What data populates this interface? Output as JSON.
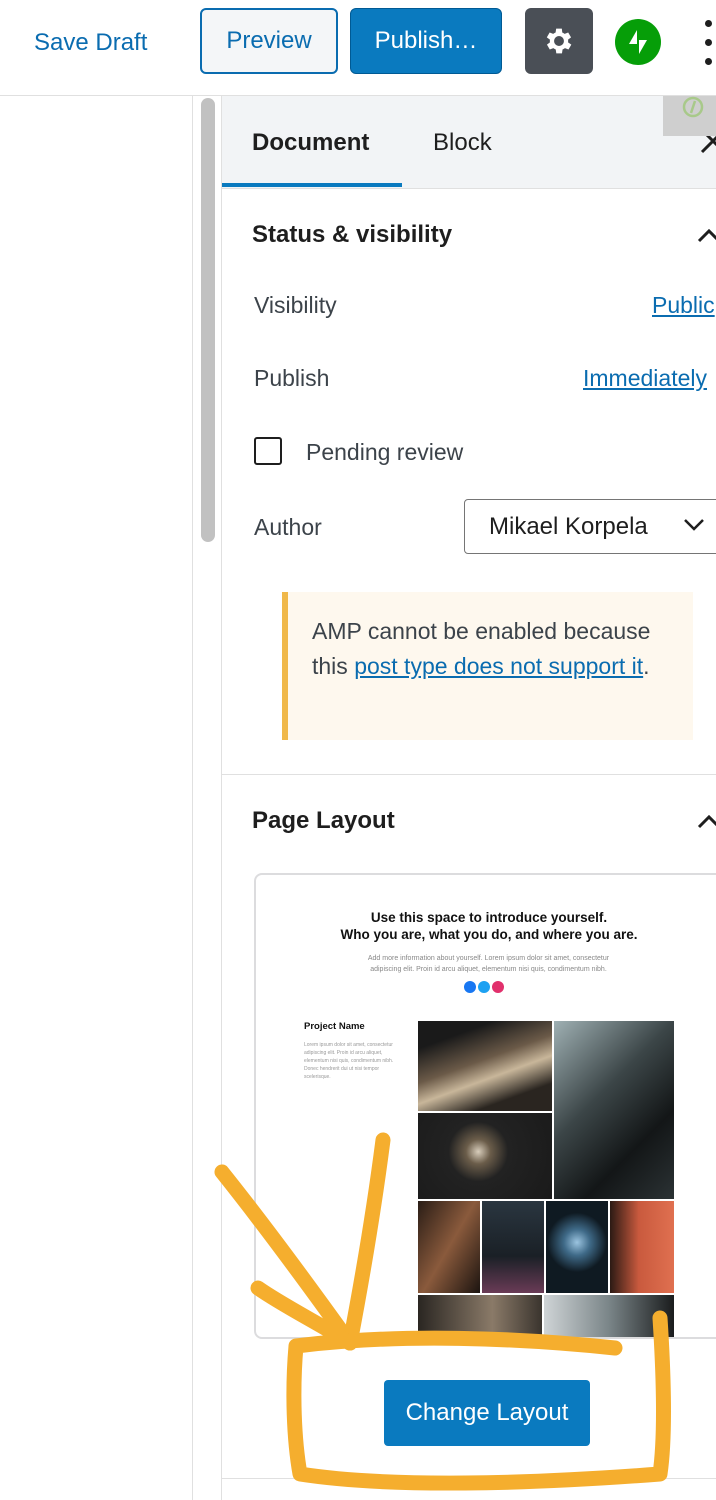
{
  "toolbar": {
    "save_draft_label": "Save Draft",
    "preview_label": "Preview",
    "publish_label": "Publish…",
    "settings_icon": "gear-icon",
    "jetpack_icon": "jetpack-bolt-icon",
    "more_icon": "kebab-menu-icon"
  },
  "sidebar": {
    "tabs": [
      {
        "label": "Document",
        "active": true
      },
      {
        "label": "Block",
        "active": false
      }
    ],
    "status_visibility": {
      "title": "Status & visibility",
      "visibility_label": "Visibility",
      "visibility_value": "Public",
      "publish_label": "Publish",
      "publish_value": "Immediately",
      "pending_review_label": "Pending review",
      "pending_review_checked": false,
      "author_label": "Author",
      "author_value": "Mikael Korpela"
    },
    "amp_notice": {
      "text_before": "AMP cannot be enabled because this ",
      "link_text": "post type does not support it",
      "text_after": "."
    },
    "page_layout": {
      "title": "Page Layout",
      "preview": {
        "heading_line1": "Use this space to introduce yourself.",
        "heading_line2": "Who you are, what you do, and where you are.",
        "subtext": "Add more information about yourself. Lorem ipsum dolor sit amet, consectetur adipiscing elit. Proin id arcu aliquet, elementum nisi quis, condimentum nibh.",
        "project_name": "Project Name",
        "project_desc": "Lorem ipsum dolor sit amet, consectetur adipiscing elit. Proin id arcu aliquet, elementum nisi quis, condimentum nibh. Donec hendrerit dui ut nisi tempor scelerisque."
      },
      "change_layout_label": "Change Layout"
    }
  },
  "colors": {
    "accent": "#0a7abf",
    "link": "#0a6cb0",
    "notice_border": "#f0b849",
    "notice_bg": "#fef8ee",
    "annotation": "#f5ae2e",
    "jetpack_green": "#069e08"
  }
}
